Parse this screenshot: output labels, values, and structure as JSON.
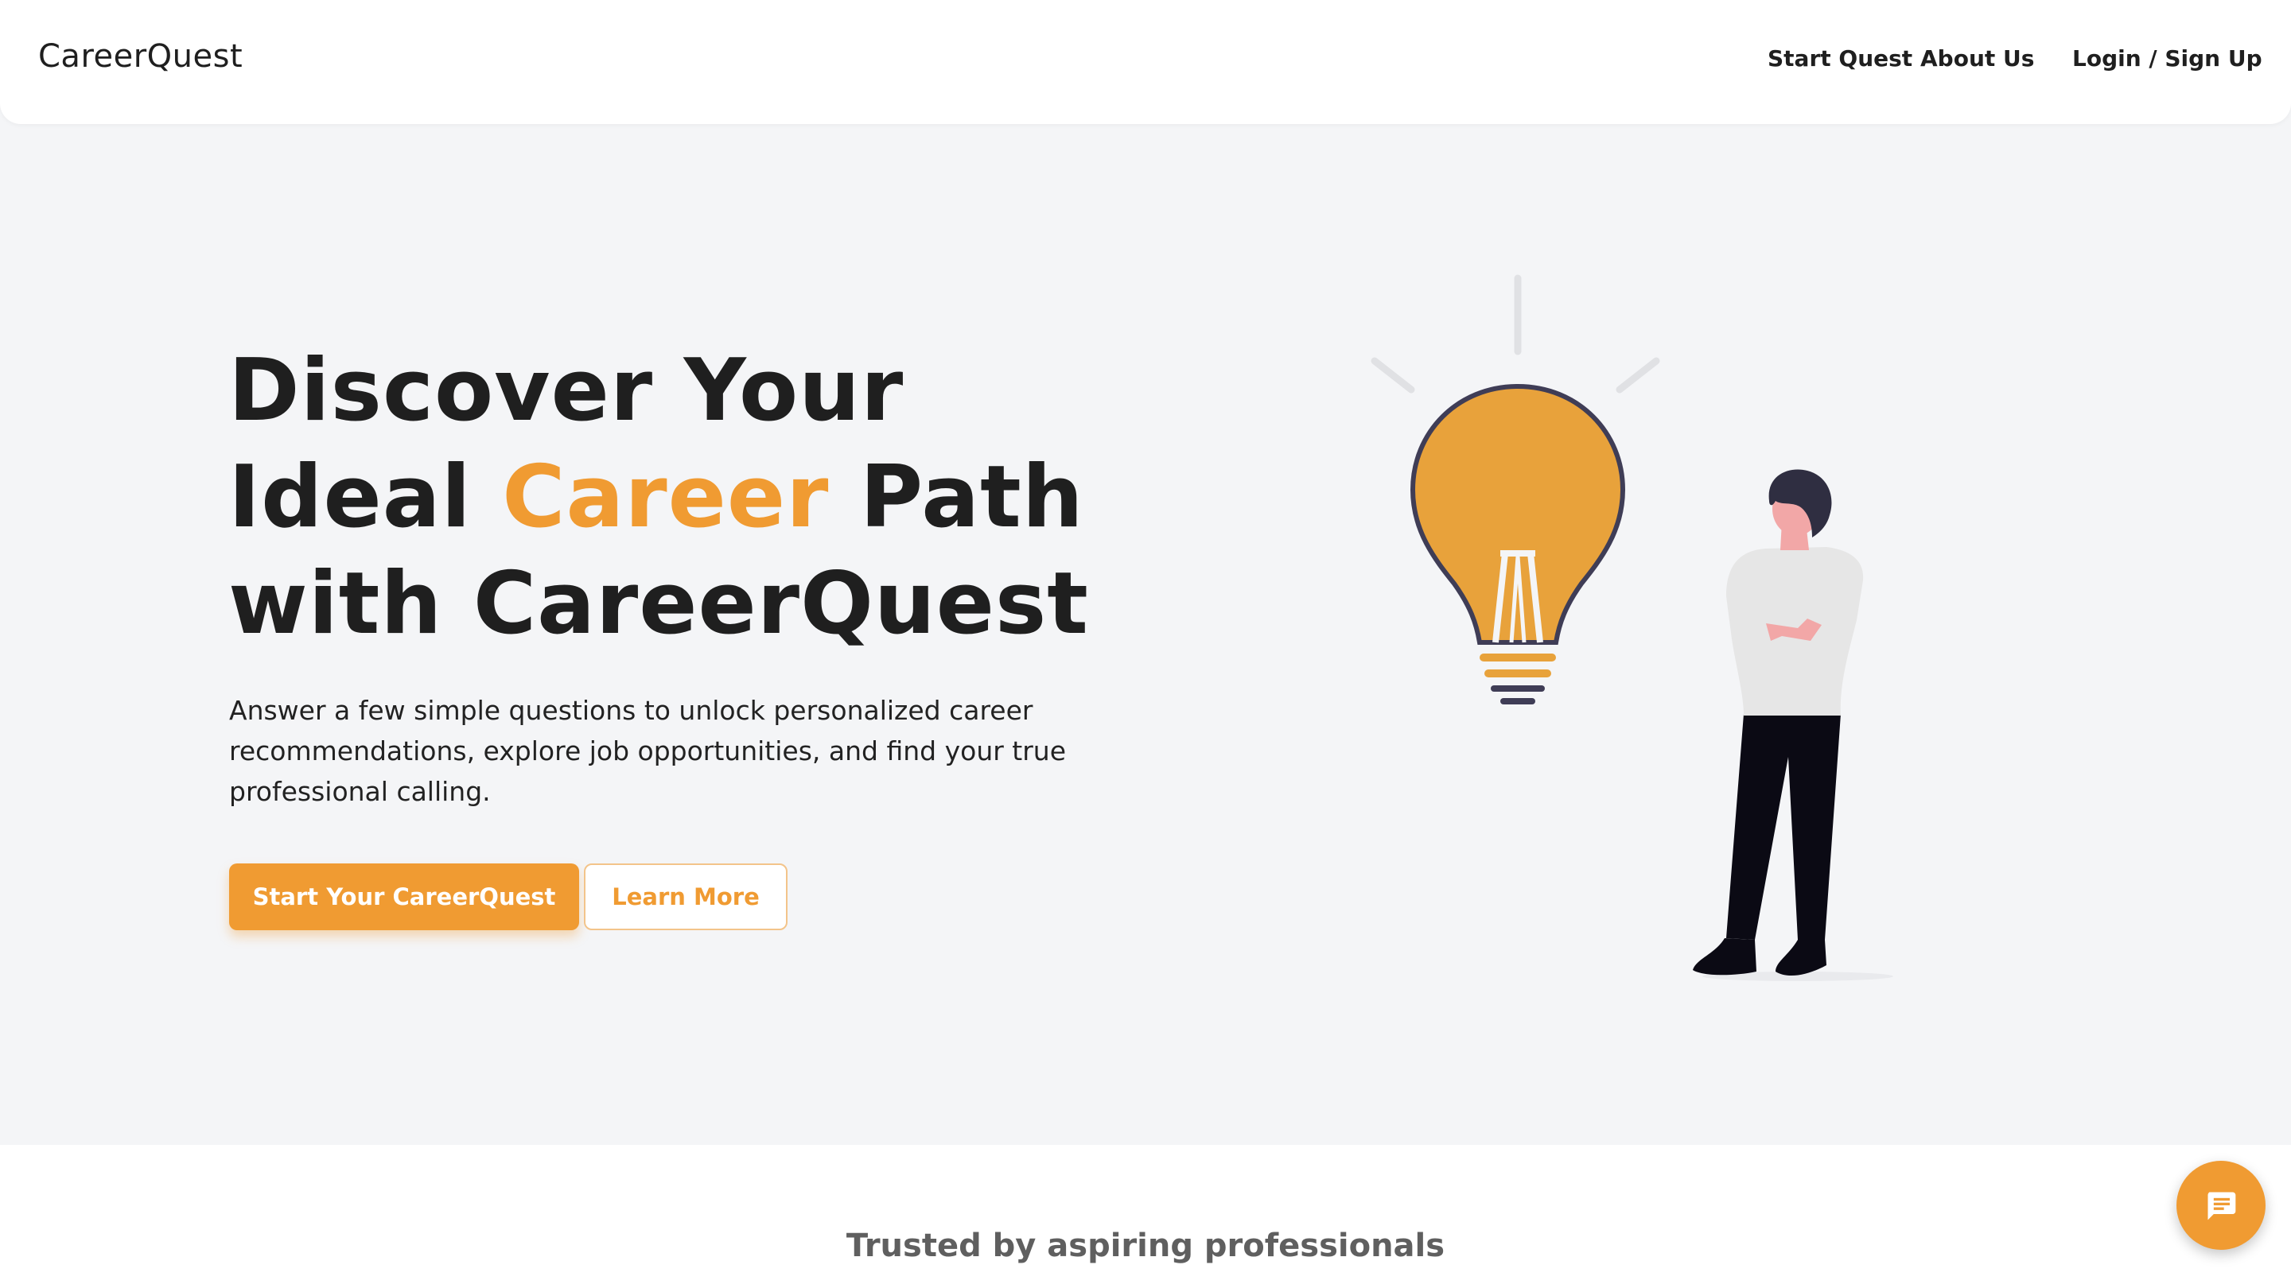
{
  "brand": "CareerQuest",
  "nav": {
    "start_quest": "Start Quest",
    "about_us": "About Us",
    "login": "Login / Sign Up"
  },
  "hero": {
    "headline_line1": "Discover Your",
    "headline_line2_pre": "Ideal",
    "headline_line2_accent": "Career",
    "headline_line2_post": "Path",
    "headline_line3": "with CareerQuest",
    "subtext": "Answer a few simple questions to unlock personalized career recommendations, explore job opportunities, and find your true professional calling.",
    "primary_cta": "Start Your CareerQuest",
    "secondary_cta": "Learn More",
    "illustration": "lightbulb-person-illustration"
  },
  "trusted": {
    "title": "Trusted by aspiring professionals"
  },
  "chat": {
    "icon": "chat-icon"
  },
  "colors": {
    "accent": "#f09b32",
    "bulb": "#e8a23b",
    "hero_bg": "#f4f5f7",
    "text": "#1f1f1f"
  }
}
